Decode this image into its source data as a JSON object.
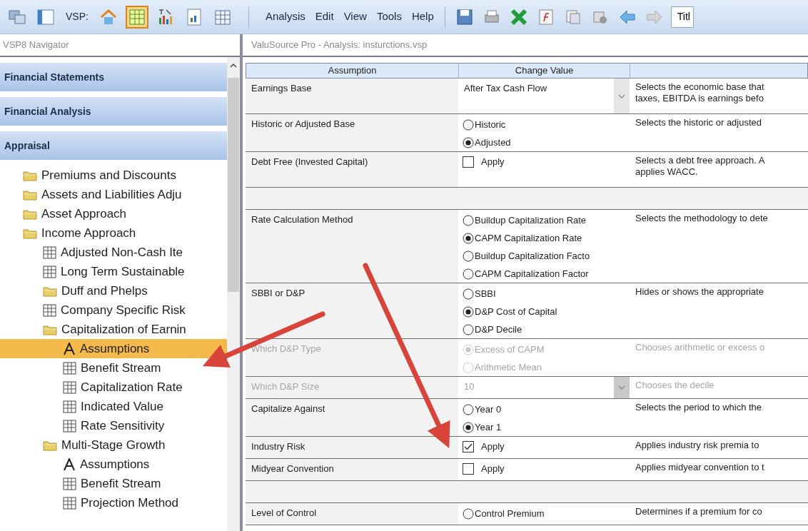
{
  "toolbar": {
    "left_buttons": [
      {
        "kind": "windows",
        "selected": false
      },
      {
        "kind": "panel",
        "selected": false
      },
      {
        "kind": "label",
        "text": "VSP:"
      },
      {
        "kind": "home",
        "selected": false
      },
      {
        "kind": "grid",
        "selected": true
      },
      {
        "kind": "chart",
        "selected": false
      },
      {
        "kind": "report",
        "selected": false
      },
      {
        "kind": "calendar",
        "selected": false
      }
    ],
    "menu": [
      "Analysis",
      "Edit",
      "View",
      "Tools",
      "Help"
    ],
    "right_buttons": [
      {
        "kind": "save"
      },
      {
        "kind": "print"
      },
      {
        "kind": "excel"
      },
      {
        "kind": "formula"
      },
      {
        "kind": "copy"
      },
      {
        "kind": "tools"
      },
      {
        "kind": "back"
      },
      {
        "kind": "forward"
      }
    ],
    "title_field": "Titl"
  },
  "navigator": {
    "title": "VSP8 Navigator",
    "sections": [
      {
        "label": "Financial Statements"
      },
      {
        "label": "Financial Analysis"
      },
      {
        "label": "Appraisal"
      }
    ],
    "tree": [
      {
        "label": "Premiums and Discounts",
        "kind": "folder",
        "selected": false
      },
      {
        "label": "Assets and Liabilities Adju",
        "kind": "folder",
        "selected": false
      },
      {
        "label": "Asset Approach",
        "kind": "folder",
        "selected": false
      },
      {
        "label": "Income Approach",
        "kind": "folder",
        "selected": false,
        "children": [
          {
            "label": "Adjusted Non-Cash Ite",
            "kind": "table",
            "selected": false
          },
          {
            "label": "Long Term Sustainable",
            "kind": "table",
            "selected": false
          },
          {
            "label": "Duff and Phelps",
            "kind": "folder",
            "selected": false
          },
          {
            "label": "Company Specific Risk",
            "kind": "table",
            "selected": false
          },
          {
            "label": "Capitalization of Earnin",
            "kind": "folder",
            "selected": false,
            "children": [
              {
                "label": "Assumptions",
                "kind": "text",
                "selected": true
              },
              {
                "label": "Benefit Stream",
                "kind": "table",
                "selected": false
              },
              {
                "label": "Capitalization Rate",
                "kind": "table",
                "selected": false
              },
              {
                "label": "Indicated Value",
                "kind": "table",
                "selected": false
              },
              {
                "label": "Rate Sensitivity",
                "kind": "table",
                "selected": false
              }
            ]
          },
          {
            "label": "Multi-Stage Growth",
            "kind": "folder",
            "selected": false,
            "children": [
              {
                "label": "Assumptions",
                "kind": "text",
                "selected": false
              },
              {
                "label": "Benefit Stream",
                "kind": "table",
                "selected": false
              },
              {
                "label": "Projection Method",
                "kind": "table",
                "selected": false
              }
            ]
          }
        ]
      }
    ]
  },
  "document": {
    "title": "ValuSource Pro - Analysis: insturctions.vsp",
    "columns": [
      "Assumption",
      "Change Value"
    ],
    "rows": [
      {
        "kind": "dropdown",
        "label": "Earnings Base",
        "value": "After Tax Cash Flow",
        "description": [
          "Selects the economic base that",
          "taxes, EBITDA is earnings befo"
        ],
        "disabled": false
      },
      {
        "kind": "radio",
        "label": "Historic or Adjusted Base",
        "options": [
          {
            "label": "Historic",
            "selected": false
          },
          {
            "label": "Adjusted",
            "selected": true
          }
        ],
        "description": [
          "Selects the historic or adjusted"
        ],
        "disabled": false
      },
      {
        "kind": "checkbox",
        "label": "Debt Free (Invested Capital)",
        "option": "Apply",
        "checked": false,
        "description": [
          "Selects a debt free approach. A",
          "applies WACC."
        ],
        "disabled": false
      },
      {
        "kind": "blank"
      },
      {
        "kind": "radio",
        "label": "Rate Calculation Method",
        "options": [
          {
            "label": "Buildup Capitalization Rate",
            "selected": false
          },
          {
            "label": "CAPM Capitalization Rate",
            "selected": true
          },
          {
            "label": "Buildup Capitalization Facto",
            "selected": false
          },
          {
            "label": "CAPM Capitalization Factor",
            "selected": false
          }
        ],
        "description": [
          "Selects the methodology to dete"
        ],
        "disabled": false
      },
      {
        "kind": "radio",
        "label": "SBBI or D&P",
        "options": [
          {
            "label": "SBBI",
            "selected": false
          },
          {
            "label": "D&P Cost of Capital",
            "selected": true
          },
          {
            "label": "D&P Decile",
            "selected": false
          }
        ],
        "description": [
          "Hides or shows the appropriate"
        ],
        "disabled": false
      },
      {
        "kind": "radio",
        "label": "Which D&P Type",
        "options": [
          {
            "label": "Excess of CAPM",
            "selected": true
          },
          {
            "label": "Arithmetic Mean",
            "selected": false
          }
        ],
        "description": [
          "Chooses arithmetic or excess o"
        ],
        "disabled": true
      },
      {
        "kind": "dropdown",
        "label": "Which D&P Size",
        "value": "10",
        "description": [
          "Chooses the decile"
        ],
        "disabled": true
      },
      {
        "kind": "radio",
        "label": "Capitalize Against",
        "options": [
          {
            "label": "Year 0",
            "selected": false
          },
          {
            "label": "Year 1",
            "selected": true
          }
        ],
        "description": [
          "Selects the period to which the"
        ],
        "disabled": false
      },
      {
        "kind": "checkbox",
        "label": "Industry Risk",
        "option": "Apply",
        "checked": true,
        "description": [
          "Applies industry risk premia to"
        ],
        "disabled": false
      },
      {
        "kind": "checkbox",
        "label": "Midyear Convention",
        "option": "Apply",
        "checked": false,
        "description": [
          "Applies midyear convention to t"
        ],
        "disabled": false
      },
      {
        "kind": "blank"
      },
      {
        "kind": "radio",
        "label": "Level of Control",
        "options": [
          {
            "label": "Control Premium",
            "selected": false
          }
        ],
        "description": [
          "Determines if a premium for co"
        ],
        "disabled": false
      }
    ]
  }
}
